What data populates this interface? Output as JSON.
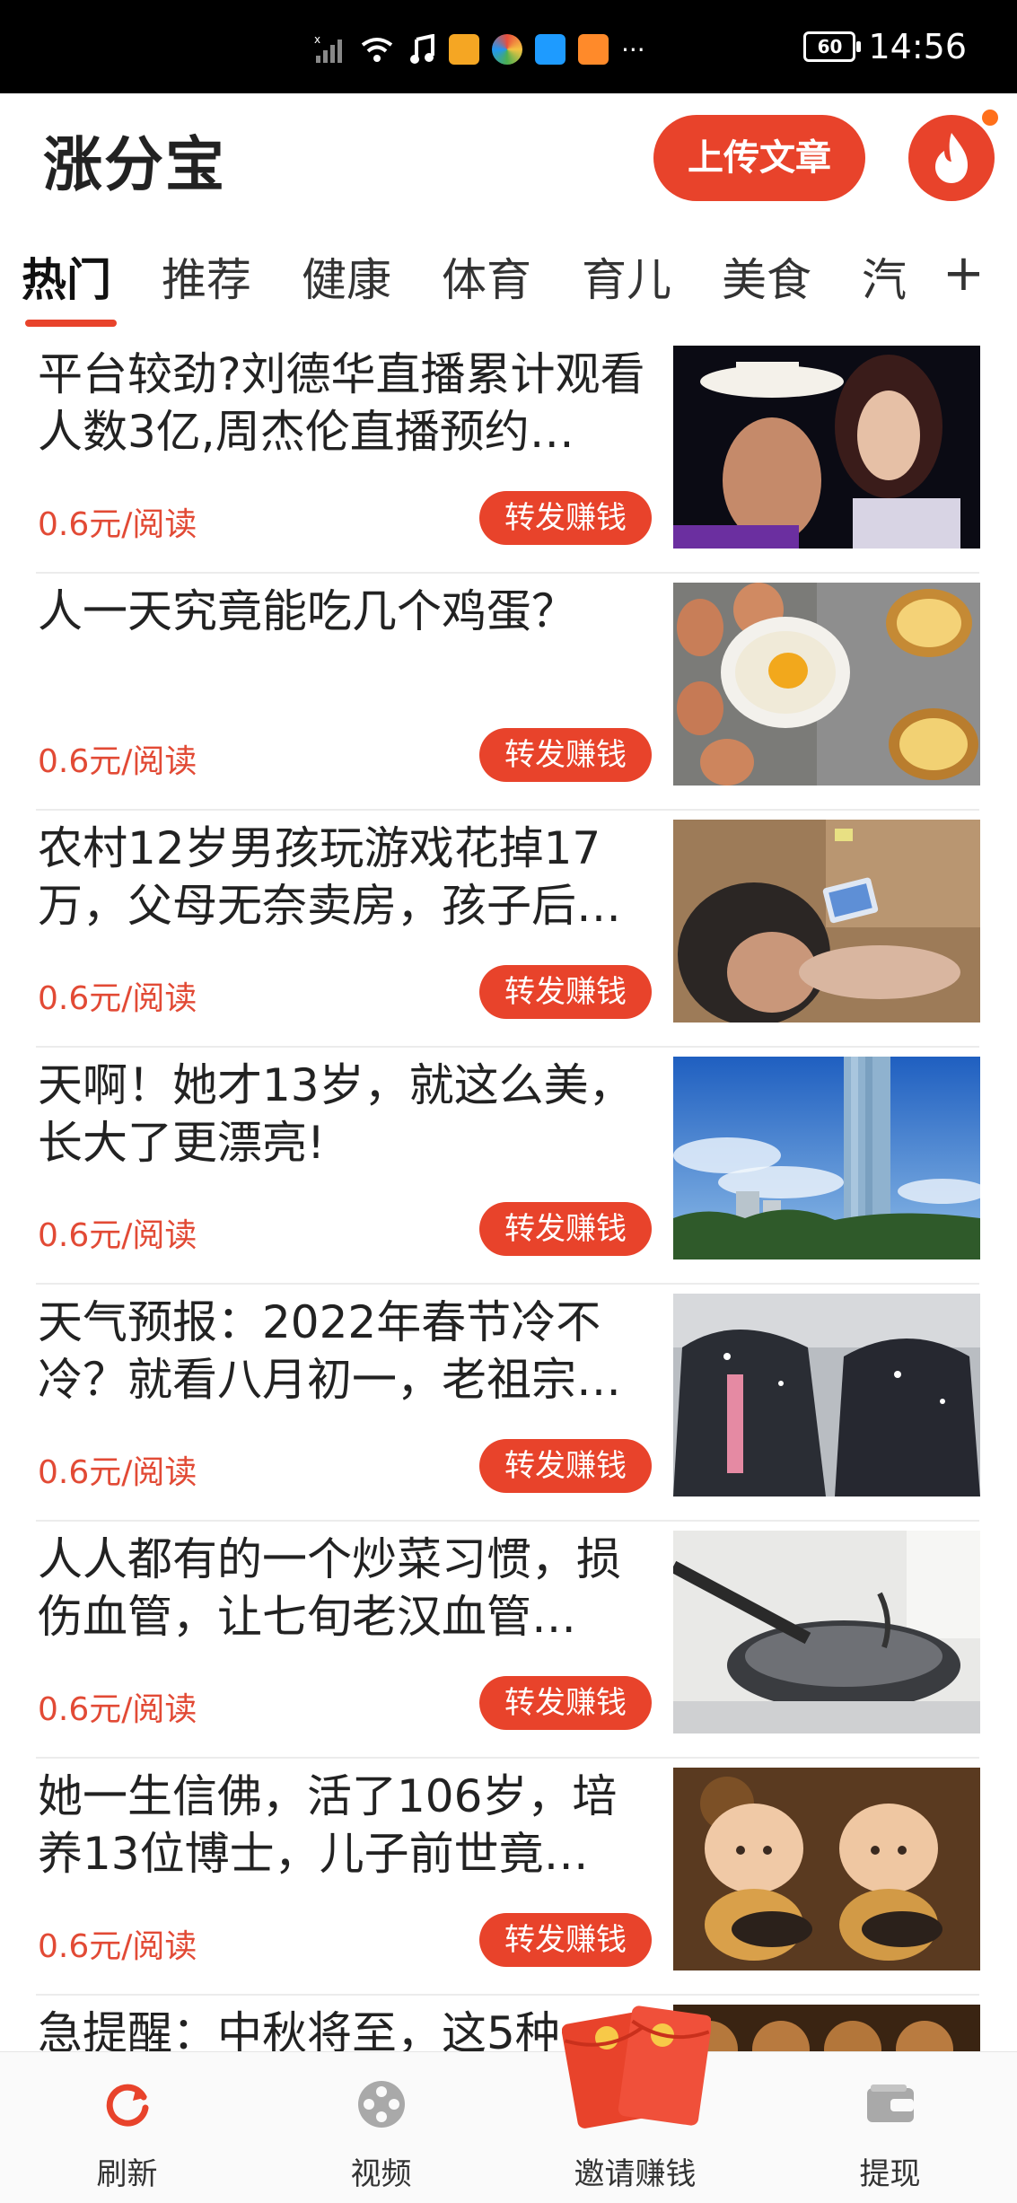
{
  "status_bar": {
    "battery": "60",
    "time": "14:56",
    "more": "···"
  },
  "header": {
    "app_name": "涨分宝",
    "upload_button": "上传文章",
    "hot_icon": "fire-icon"
  },
  "tabs": [
    "热门",
    "推荐",
    "健康",
    "体育",
    "育儿",
    "美食",
    "汽",
    "+"
  ],
  "feed": {
    "items": [
      {
        "title": "平台较劲?刘德华直播累计观看人数3亿,周杰伦直播预约…",
        "price": "0.6元/阅读",
        "button": "转发赚钱",
        "thumb": "couple-photo"
      },
      {
        "title": "人一天究竟能吃几个鸡蛋？",
        "price": "0.6元/阅读",
        "button": "转发赚钱",
        "thumb": "eggs-photo"
      },
      {
        "title": "农村12岁男孩玩游戏花掉17万，父母无奈卖房，孩子后…",
        "price": "0.6元/阅读",
        "button": "转发赚钱",
        "thumb": "boy-phone-photo"
      },
      {
        "title": "天啊！她才13岁，就这么美，长大了更漂亮!",
        "price": "0.6元/阅读",
        "button": "转发赚钱",
        "thumb": "skyscraper-photo"
      },
      {
        "title": "天气预报：2022年春节冷不冷？就看八月初一，老祖宗…",
        "price": "0.6元/阅读",
        "button": "转发赚钱",
        "thumb": "snow-people-photo"
      },
      {
        "title": "人人都有的一个炒菜习惯，损伤血管，让七旬老汉血管…",
        "price": "0.6元/阅读",
        "button": "转发赚钱",
        "thumb": "wok-photo"
      },
      {
        "title": "她一生信佛，活了106岁，培养13位博士，儿子前世竟…",
        "price": "0.6元/阅读",
        "button": "转发赚钱",
        "thumb": "monk-figurines-photo"
      },
      {
        "title": "急提醒：中秋将至，这5种",
        "price": "",
        "button": "",
        "thumb": "mooncakes-photo"
      }
    ]
  },
  "bottom_nav": [
    {
      "label": "刷新",
      "icon": "refresh-icon"
    },
    {
      "label": "视频",
      "icon": "film-reel-icon"
    },
    {
      "label": "邀请赚钱",
      "icon": "red-packet-icon"
    },
    {
      "label": "提现",
      "icon": "wallet-icon"
    }
  ],
  "colors": {
    "accent": "#e8432b",
    "price": "#e24a35"
  }
}
